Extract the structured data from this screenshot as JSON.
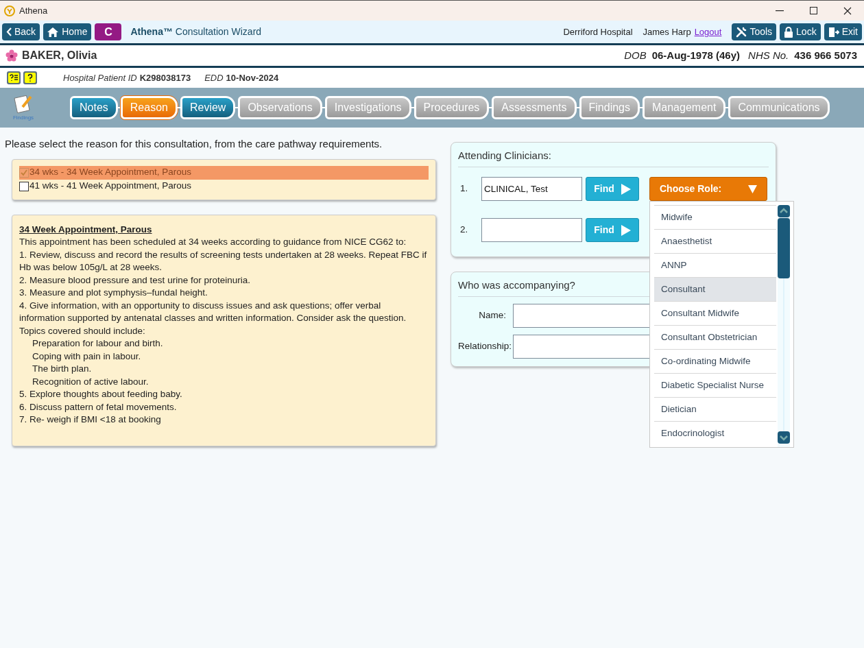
{
  "window": {
    "title": "Athena"
  },
  "toolbar": {
    "back": "Back",
    "home": "Home",
    "app_badge": "C",
    "app_title": "Athena™",
    "app_subtitle": "Consultation Wizard",
    "hospital": "Derriford Hospital",
    "user": "James Harp",
    "logout": "Logout",
    "buttons": [
      {
        "kind": "tools",
        "label": "Tools"
      },
      {
        "kind": "lock",
        "label": "Lock"
      },
      {
        "kind": "exit",
        "label": "Exit"
      }
    ]
  },
  "patient": {
    "name": "BAKER, Olivia",
    "dob_label": "DOB",
    "dob": "06-Aug-1978 (46y)",
    "nhs_label": "NHS No.",
    "nhs": "436 966 5073",
    "id_label": "Hospital Patient ID",
    "id": "K298038173",
    "edd_label": "EDD",
    "edd": "10-Nov-2024"
  },
  "wizard": {
    "icon_label": "Findings",
    "steps": [
      {
        "label": "Notes",
        "kind": "complete",
        "selected": false
      },
      {
        "label": "Reason",
        "kind": "active",
        "selected": true
      },
      {
        "label": "Review",
        "kind": "complete",
        "selected": false
      },
      {
        "label": "Observations",
        "kind": "pending",
        "selected": false
      },
      {
        "label": "Investigations",
        "kind": "pending",
        "selected": false
      },
      {
        "label": "Procedures",
        "kind": "pending",
        "selected": false
      },
      {
        "label": "Assessments",
        "kind": "pending",
        "selected": false
      },
      {
        "label": "Findings",
        "kind": "pending",
        "selected": false
      },
      {
        "label": "Management",
        "kind": "pending",
        "selected": false
      },
      {
        "label": "Communications",
        "kind": "pending",
        "selected": false
      }
    ]
  },
  "instruction": "Please select the reason for this consultation, from the care pathway requirements.",
  "reasons": [
    {
      "label": "34 wks - 34 Week Appointment, Parous",
      "checked": true,
      "selected": true,
      "disabled": true
    },
    {
      "label": "41 wks - 41 Week Appointment, Parous",
      "checked": false,
      "selected": false,
      "disabled": false
    }
  ],
  "description": {
    "heading": "34 Week Appointment, Parous",
    "lines": [
      {
        "kind": "line",
        "text": "This appointment has been scheduled at 34 weeks according to guidance from NICE CG62 to:"
      },
      {
        "kind": "line",
        "text": "1. Review, discuss and record the results of screening tests undertaken at 28 weeks. Repeat FBC if Hb was below 105g/L at 28 weeks."
      },
      {
        "kind": "line",
        "text": "2. Measure blood pressure and test urine for proteinuria."
      },
      {
        "kind": "line",
        "text": "3. Measure and plot symphysis–fundal height."
      },
      {
        "kind": "line",
        "text": "4. Give information, with an opportunity to discuss issues and ask questions; offer verbal information supported by antenatal classes and written information. Consider ask the question."
      },
      {
        "kind": "line",
        "text": "Topics covered should include:"
      },
      {
        "kind": "sub",
        "text": "Preparation for labour and birth."
      },
      {
        "kind": "sub",
        "text": "Coping with pain in labour."
      },
      {
        "kind": "sub",
        "text": "The birth plan."
      },
      {
        "kind": "sub",
        "text": "Recognition of active labour."
      },
      {
        "kind": "line",
        "text": "5. Explore thoughts about feeding baby."
      },
      {
        "kind": "line",
        "text": "6. Discuss pattern of fetal movements."
      },
      {
        "kind": "line",
        "text": "7. Re- weigh if BMI <18  at booking"
      }
    ]
  },
  "clinicians": {
    "title": "Attending Clinicians:",
    "rows": [
      {
        "number": "1.",
        "value": "CLINICAL, Test",
        "find": "Find",
        "role_button": "Choose Role:"
      },
      {
        "number": "2.",
        "value": "",
        "find": "Find"
      }
    ]
  },
  "accompanying": {
    "title": "Who was accompanying?",
    "fields": [
      {
        "label": "Name:"
      },
      {
        "label": "Relationship:"
      }
    ]
  },
  "role_menu": [
    {
      "label": "Midwife",
      "selected": false
    },
    {
      "label": "Anaesthetist",
      "selected": false
    },
    {
      "label": "ANNP",
      "selected": false
    },
    {
      "label": "Consultant",
      "selected": true
    },
    {
      "label": "Consultant Midwife",
      "selected": false
    },
    {
      "label": "Consultant Obstetrician",
      "selected": false
    },
    {
      "label": "Co-ordinating Midwife",
      "selected": false
    },
    {
      "label": "Diabetic Specialist Nurse",
      "selected": false
    },
    {
      "label": "Dietician",
      "selected": false
    },
    {
      "label": "Endocrinologist",
      "selected": false
    }
  ]
}
